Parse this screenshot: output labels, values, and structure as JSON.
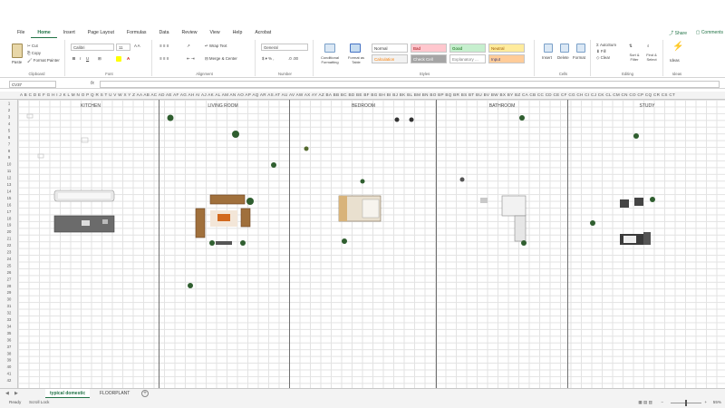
{
  "menu": {
    "tabs": [
      "File",
      "Home",
      "Insert",
      "Page Layout",
      "Formulas",
      "Data",
      "Review",
      "View",
      "Help",
      "Acrobat"
    ],
    "active": "Home",
    "share": "Share",
    "comments": "Comments"
  },
  "ribbon": {
    "clipboard": {
      "paste": "Paste",
      "cut": "Cut",
      "copy": "Copy",
      "format_painter": "Format Painter",
      "label": "Clipboard"
    },
    "font": {
      "name": "Calibri",
      "size": "11",
      "label": "Font"
    },
    "alignment": {
      "wrap_text": "Wrap Text",
      "merge_center": "Merge & Center",
      "label": "Alignment"
    },
    "number": {
      "format": "General",
      "label": "Number"
    },
    "styles": {
      "conditional": "Conditional Formatting",
      "format_table": "Format as Table",
      "label": "Styles",
      "cells": [
        {
          "text": "Normal",
          "bg": "#ffffff",
          "color": "#333333"
        },
        {
          "text": "Bad",
          "bg": "#ffc7ce",
          "color": "#9c0006"
        },
        {
          "text": "Good",
          "bg": "#c6efce",
          "color": "#006100"
        },
        {
          "text": "Neutral",
          "bg": "#ffeb9c",
          "color": "#9c5700"
        },
        {
          "text": "Calculation",
          "bg": "#f2f2f2",
          "color": "#fa7d00"
        },
        {
          "text": "Check Cell",
          "bg": "#a5a5a5",
          "color": "#ffffff"
        },
        {
          "text": "Explanatory ...",
          "bg": "#ffffff",
          "color": "#7f7f7f"
        },
        {
          "text": "Input",
          "bg": "#ffcc99",
          "color": "#3f3f76"
        }
      ]
    },
    "cells": {
      "insert": "Insert",
      "delete": "Delete",
      "format": "Format",
      "label": "Cells"
    },
    "editing": {
      "autosum": "AutoSum",
      "fill": "Fill",
      "clear": "Clear",
      "sort_filter": "Sort & Filter",
      "find_select": "Find & Select",
      "label": "Editing"
    },
    "ideas": {
      "text": "Ideas",
      "label": "Ideas"
    }
  },
  "formula_bar": {
    "name_box": "CV37",
    "fx": "fx",
    "value": ""
  },
  "columns": "A B C D E F G H I J K L M N O P Q R S T U V W X Y Z AA AB AC AD AE AF AG AH AI AJ AK AL AM AN AO AP AQ AR AS AT AU AV AW AX AY AZ BA BB BC BD BE BF BG BH BI BJ BK BL BM BN BO BP BQ BR BS BT BU BV BW BX BY BZ CA CB CC CD CE CF CG CH CI CJ CK CL CM CN CO CP CQ CR CS CT",
  "rows": [
    "1",
    "2",
    "3",
    "4",
    "5",
    "6",
    "7",
    "8",
    "9",
    "10",
    "11",
    "12",
    "13",
    "14",
    "15",
    "16",
    "17",
    "18",
    "19",
    "20",
    "21",
    "22",
    "23",
    "24",
    "25",
    "26",
    "27",
    "28",
    "29",
    "30",
    "31",
    "32",
    "33",
    "34",
    "35",
    "36",
    "37",
    "38",
    "39",
    "40",
    "41",
    "42"
  ],
  "rooms": [
    "KITCHEN",
    "LIVING ROOM",
    "BEDROOM",
    "BATHROOM",
    "STUDY"
  ],
  "sheets": {
    "active": "typical domestic",
    "other": "FLOORPLANT"
  },
  "status": {
    "ready": "Ready",
    "scroll_lock": "Scroll Lock",
    "zoom": "55%"
  },
  "colors": {
    "accent": "#217346",
    "plant": "#2f5e2f",
    "wood": "#a0703c",
    "rug_orange": "#d2691e",
    "counter_gray": "#6b6b6b"
  }
}
